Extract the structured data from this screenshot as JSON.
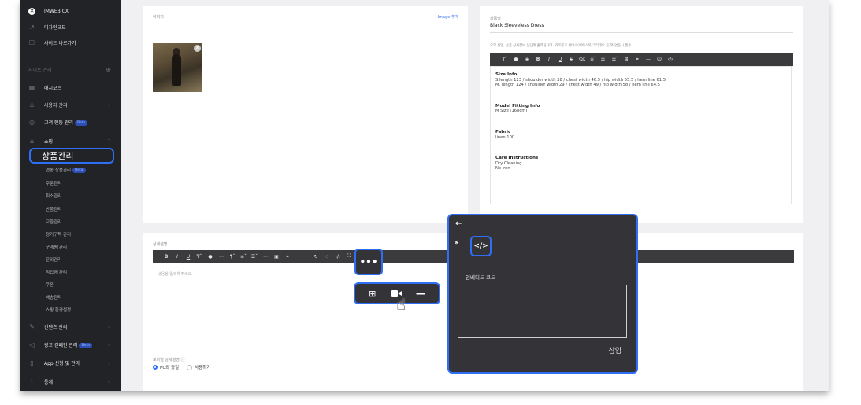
{
  "sidebar": {
    "brand": "IMWEB CX",
    "design_mode": "디자인모드",
    "go_site": "사이트 바로가기",
    "section_label": "사이트 관리",
    "dashboard": "대시보드",
    "user_mgmt": "사용자 관리",
    "customer_behavior": "고객 행동 관리",
    "beta": "Beta",
    "shopping": "쇼핑",
    "active_item": "상품관리",
    "sub_items": [
      "연동 상품관리",
      "주문관리",
      "취소관리",
      "반품관리",
      "교환관리",
      "정기구독 관리",
      "구매평 관리",
      "문의관리",
      "적립금 관리",
      "쿠폰",
      "배송관리",
      "쇼핑 환경설정"
    ],
    "content_mgmt": "컨텐츠 관리",
    "ad_campaign": "광고 캠페인 관리",
    "app_apply": "App 신청 및 관리",
    "stats": "통계"
  },
  "image_panel": {
    "label": "이미지",
    "add_link": "Image 추가"
  },
  "product_panel": {
    "name_label": "상품명",
    "name_value": "Black Sleeveless Dress",
    "summary_label": "요약 설명, 상품 상세정보 상단에 출력됩니다. 외부광고 서비스(페이스북/크리테오 등)와 연동시 필수",
    "sections": [
      {
        "title": "Size Info",
        "lines": [
          "S.length 123 / shoulder width 28 / chest width 46.5 / hip width 55.5 / hem line 61.5",
          "M. length 124 / shoulder width 29 / chest width 49 / hip width 58 / hem line 64.5"
        ]
      },
      {
        "title": "Model Fitting Info",
        "lines": [
          "M Size (168cm)"
        ]
      },
      {
        "title": "Fabric",
        "lines": [
          "linen 100"
        ]
      },
      {
        "title": "Care Instructions",
        "lines": [
          "Dry Cleaning",
          "No iron"
        ]
      }
    ]
  },
  "detail_panel": {
    "label": "상세설명",
    "placeholder": "내용을 입력해주세요.",
    "mobile_label": "모바일 상세설명",
    "radio_same": "PC와 동일",
    "radio_use": "사용하기"
  },
  "more_popup": {
    "more_icon": "ellipsis-icon",
    "items": [
      "table-icon",
      "video-icon",
      "horizontal-rule-icon"
    ]
  },
  "embed_popup": {
    "back_icon": "arrow-left-icon",
    "link_icon": "link-icon",
    "code_icon": "code-icon",
    "label": "임베디드 코드",
    "insert_button": "삽입"
  },
  "colors": {
    "highlight": "#2f6ff5",
    "sidebar_bg": "#222327",
    "toolbar_bg": "#3b3b3d"
  }
}
